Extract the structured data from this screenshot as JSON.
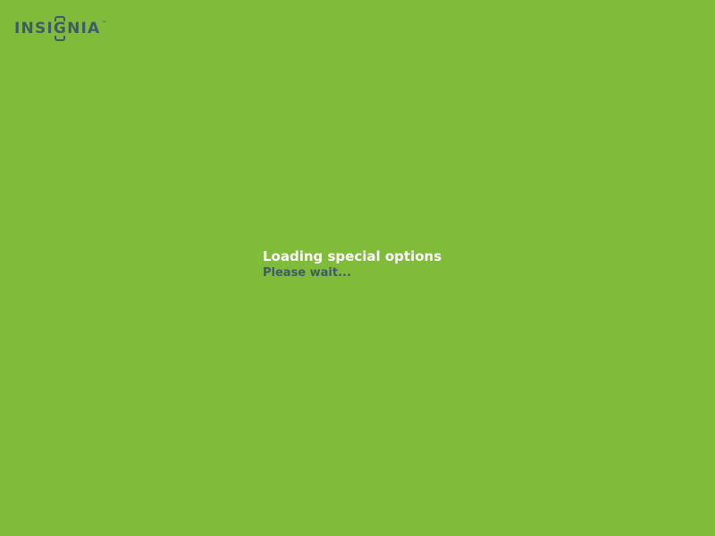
{
  "colors": {
    "background": "#80BB3A",
    "logo": "#3F5A6A",
    "title": "#FFFFFF",
    "subtitle": "#3F5A6A"
  },
  "logo": {
    "text_before": "INSI",
    "text_bracketed": "G",
    "text_after": "NIA",
    "trademark": "™"
  },
  "loading": {
    "title": "Loading special options",
    "subtitle": "Please wait..."
  }
}
